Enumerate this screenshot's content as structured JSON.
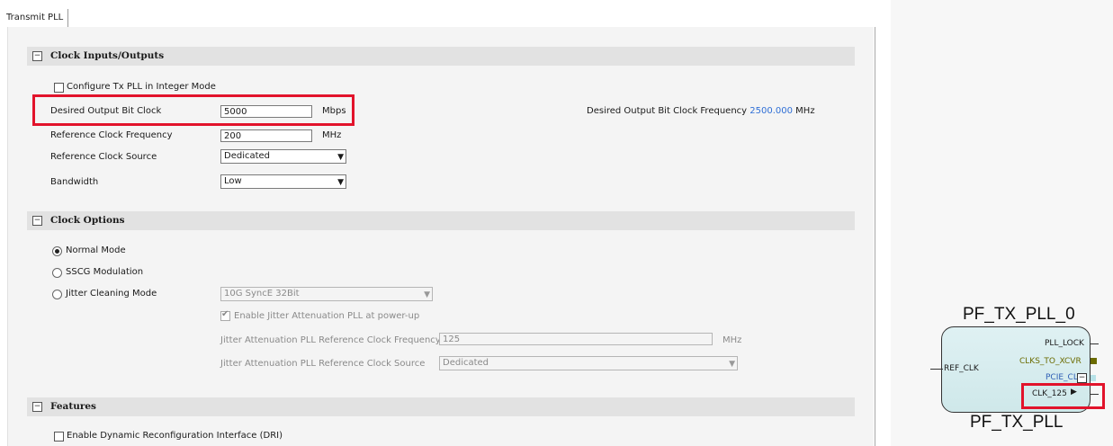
{
  "tabs": [
    {
      "label": "Transmit PLL"
    }
  ],
  "sections": {
    "clock_io": {
      "title": "Clock Inputs/Outputs",
      "integer_mode_label": "Configure Tx PLL in Integer Mode",
      "integer_mode_checked": false,
      "output_bit_clock": {
        "label": "Desired Output Bit Clock",
        "value": "5000",
        "unit": "Mbps"
      },
      "ref_clock_freq": {
        "label": "Reference Clock Frequency",
        "value": "200",
        "unit": "MHz"
      },
      "ref_clock_source": {
        "label": "Reference Clock Source",
        "value": "Dedicated"
      },
      "bandwidth": {
        "label": "Bandwidth",
        "value": "Low"
      },
      "output_freq": {
        "label": "Desired Output Bit Clock Frequency",
        "value": "2500.000",
        "unit": "MHz"
      }
    },
    "clock_options": {
      "title": "Clock Options",
      "modes": [
        {
          "label": "Normal Mode",
          "selected": true
        },
        {
          "label": "SSCG Modulation",
          "selected": false
        },
        {
          "label": "Jitter Cleaning Mode",
          "selected": false
        }
      ],
      "jitter_mode_select": "10G SyncE 32Bit",
      "enable_jitter_label": "Enable Jitter Attenuation PLL at power-up",
      "enable_jitter_checked": true,
      "jitter_ref_freq": {
        "label": "Jitter Attenuation PLL Reference Clock Frequency",
        "value": "125",
        "unit": "MHz"
      },
      "jitter_ref_source": {
        "label": "Jitter Attenuation PLL Reference Clock Source",
        "value": "Dedicated"
      }
    },
    "features": {
      "title": "Features",
      "dri_label": "Enable Dynamic Reconfiguration Interface (DRI)",
      "dri_checked": false
    }
  },
  "block": {
    "instance_name": "PF_TX_PLL_0",
    "module_name": "PF_TX_PLL",
    "ports": {
      "ref_clk": "REF_CLK",
      "pll_lock": "PLL_LOCK",
      "clks_to_xcvr": "CLKS_TO_XCVR",
      "pcie_clk": "PCIE_CLK",
      "clk_125": "CLK_125"
    }
  },
  "icons": {
    "collapse": "minus-box-icon",
    "dropdown": "down-triangle-icon",
    "expand_port": "plus-box-icon",
    "port_arrow": "right-triangle-icon"
  },
  "colors": {
    "highlight": "#e2132b",
    "frequency_value": "#2f6fd6",
    "block_fill": "#d7eef0",
    "bus_port": "#6b6b00"
  }
}
